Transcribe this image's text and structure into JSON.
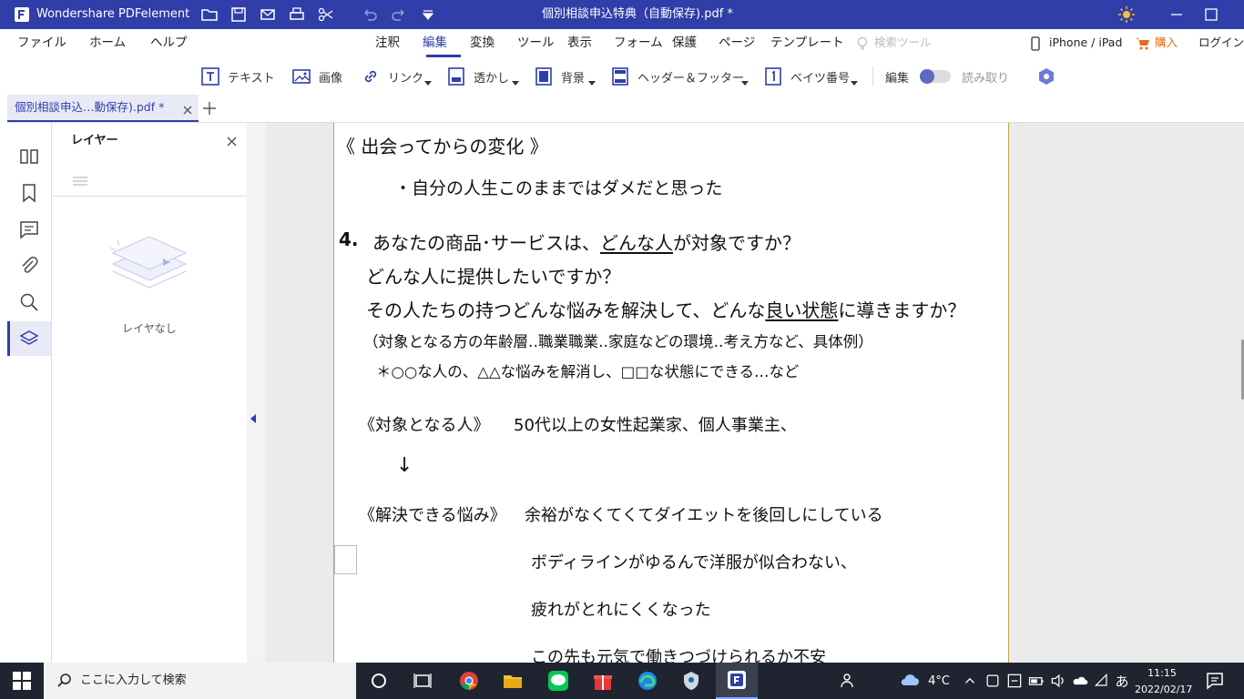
{
  "app": {
    "name": "Wondershare PDFelement",
    "document_title": "個別相談申込特典（自動保存).pdf *"
  },
  "menu": {
    "file": "ファイル",
    "home": "ホーム",
    "help": "ヘルプ",
    "tabs": [
      "注釈",
      "編集",
      "変換",
      "ツール",
      "表示",
      "フォーム",
      "保護",
      "ページ",
      "テンプレート"
    ],
    "search_tool": "検索ツール",
    "device": "iPhone / iPad",
    "buy": "購入",
    "login": "ログイン"
  },
  "toolbar": {
    "text": "テキスト",
    "image": "画像",
    "link": "リンク",
    "watermark": "透かし",
    "background": "背景",
    "header_footer": "ヘッダー＆フッター",
    "bates": "ベイツ番号",
    "edit": "編集",
    "read": "読み取り"
  },
  "tab": {
    "label": "個別相談申込…動保存).pdf *"
  },
  "layer_panel": {
    "title": "レイヤー",
    "empty": "レイヤなし"
  },
  "document": {
    "heading": "《 出会ってからの変化 》",
    "bullet": "・自分の人生このままではダメだと思った",
    "q_number": "4.",
    "q1_pre": "あなたの商品･サービスは、",
    "q1_u": "どんな人",
    "q1_post": "が対象ですか？",
    "q2": "どんな人に提供したいですか？",
    "q3_pre": "その人たちの持つどんな悩みを解決して、どんな",
    "q3_u": "良い状態",
    "q3_post": "に導きますか？",
    "note": "（対象となる方の年齢層‥職業職業‥家庭などの環境‥考え方など、具体例）",
    "example": "＊○○な人の、△△な悩みを解消し、□□な状態にできる…など",
    "target_label": "《対象となる人》",
    "target_value": "50代以上の女性起業家、個人事業主、",
    "arrow": "↓",
    "problems_label": "《解決できる悩み》",
    "problem_1": "余裕がなくてくてダイエットを後回しにしている",
    "problem_2": "ボディラインがゆるんで洋服が似合わない、",
    "problem_3": "疲れがとれにくくなった",
    "problem_4": "この先も元気で働きつづけられるか不安"
  },
  "taskbar": {
    "search_placeholder": "ここに入力して検索",
    "weather": "4°C",
    "ime": "あ",
    "time": "11:15",
    "date": "2022/02/17"
  },
  "colors": {
    "brand": "#2f3ea8",
    "page_border": "#c9a24a",
    "taskbar": "#1f2430"
  }
}
